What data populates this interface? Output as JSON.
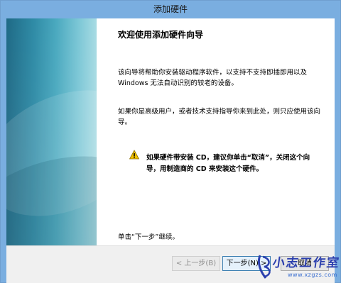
{
  "window": {
    "title": "添加硬件"
  },
  "wizard": {
    "heading": "欢迎使用添加硬件向导",
    "paragraph1": "该向导将帮助你安装驱动程序软件，以支持不支持即插即用以及 Windows 无法自动识别的较老的设备。",
    "paragraph2": "如果你是高级用户，或者技术支持指导你来到此处，则只应使用该向导。",
    "warning": "如果硬件带安装 CD，建议你单击“取消”，关闭这个向导，用制造商的 CD 来安装这个硬件。",
    "instruction": "单击“下一步”继续。"
  },
  "buttons": {
    "back": "< 上一步(B)",
    "next": "下一步(N) >",
    "cancel": "取消"
  },
  "watermark": {
    "text": "小志工作室",
    "url": "www.xzgzs.com"
  },
  "colors": {
    "titlebar": "#7aaee0",
    "banner": "#2f8ba6",
    "warning_icon": "#f2c200",
    "watermark": "#2b3fae"
  },
  "icons": {
    "warning": "warning-icon"
  }
}
